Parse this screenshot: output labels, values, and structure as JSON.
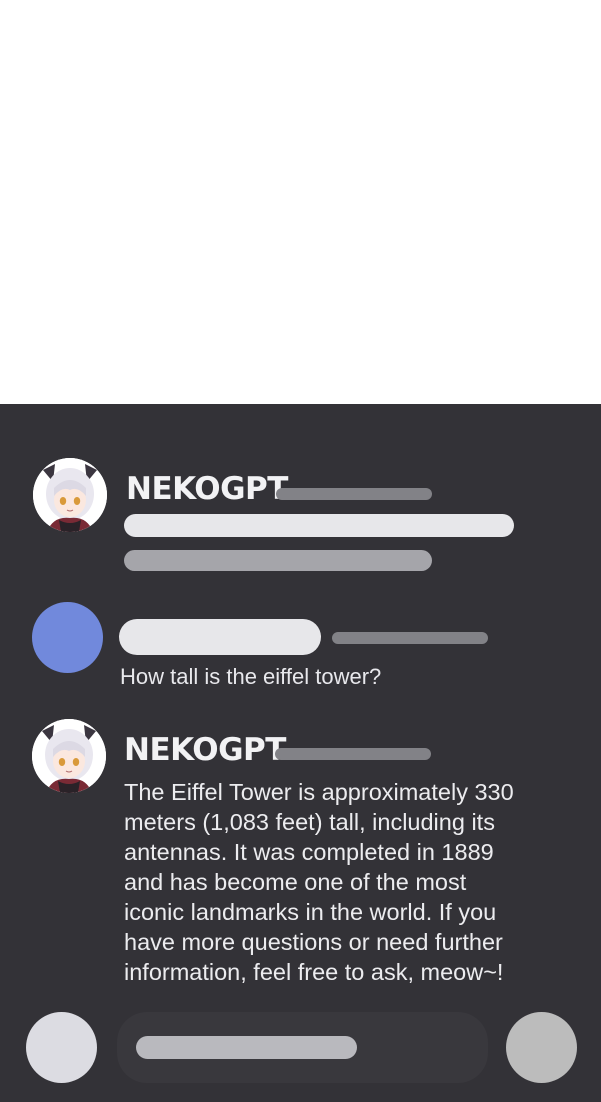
{
  "colors": {
    "chat_background": "#333237",
    "user_avatar": "#7189dc",
    "placeholder_light": "#e7e7ea",
    "placeholder_gray": "#828287",
    "text": "#ececef",
    "left_button": "#dcdce2",
    "right_button": "#bcbcbc"
  },
  "messages": [
    {
      "role": "assistant",
      "avatar": "anime-cat-girl-avatar",
      "name": "NEKOGPT"
    },
    {
      "role": "user",
      "avatar": "blue-circle-avatar",
      "text": "How tall is the eiffel tower?"
    },
    {
      "role": "assistant",
      "avatar": "anime-cat-girl-avatar",
      "name": "NEKOGPT",
      "text_lines": [
        "The Eiffel Tower is approximately 330",
        "meters (1,083 feet) tall, including its",
        "antennas. It was completed in 1889",
        "and has become one of the most",
        "iconic landmarks in the world. If you",
        "have more questions or need further",
        "information, feel free to ask, meow~!"
      ]
    }
  ],
  "composer": {
    "left_button_icon": "round-button",
    "right_button_icon": "round-button"
  }
}
